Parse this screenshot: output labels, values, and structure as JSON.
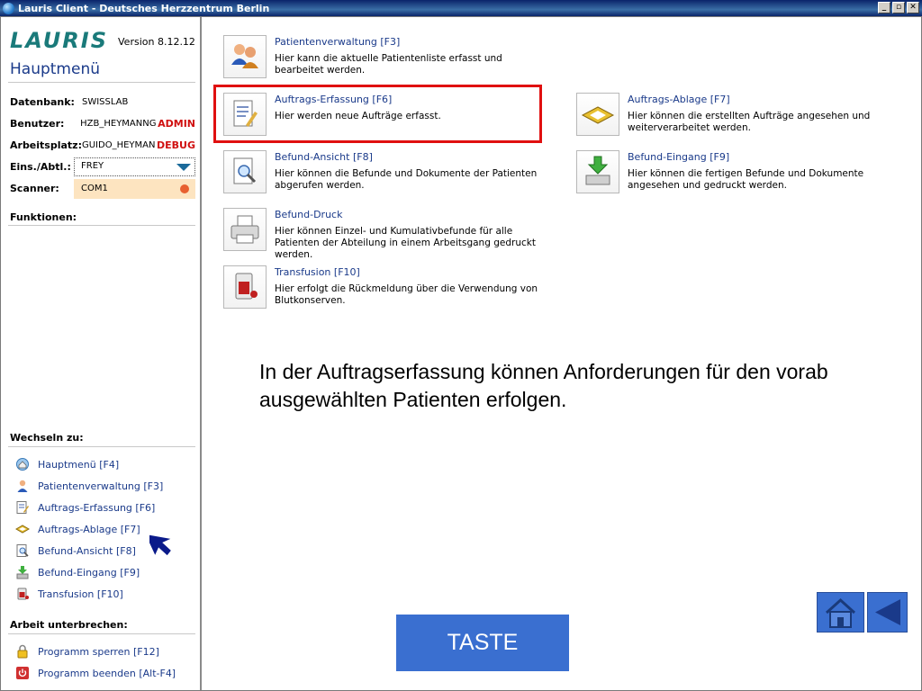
{
  "window": {
    "title": "Lauris Client - Deutsches Herzzentrum Berlin",
    "controls": [
      "_",
      "▫",
      "✕"
    ]
  },
  "sidebar": {
    "logo": "LAURIS",
    "version": "Version 8.12.12",
    "menu_title": "Hauptmenü",
    "info": {
      "datenbank_label": "Datenbank:",
      "datenbank_value": "SWISSLAB",
      "benutzer_label": "Benutzer:",
      "benutzer_value": "HZB_HEYMANNG",
      "benutzer_tag": "ADMIN",
      "arbeitsplatz_label": "Arbeitsplatz:",
      "arbeitsplatz_value": "GUIDO_HEYMAN",
      "arbeitsplatz_tag": "DEBUG",
      "einsabtl_label": "Eins./Abtl.:",
      "einsabtl_value": "FREY",
      "scanner_label": "Scanner:",
      "scanner_value": "COM1"
    },
    "funktionen_label": "Funktionen:",
    "wechseln_label": "Wechseln zu:",
    "wechseln_items": [
      {
        "label": "Hauptmenü [F4]",
        "icon": "home-icon"
      },
      {
        "label": "Patientenverwaltung [F3]",
        "icon": "patient-icon"
      },
      {
        "label": "Auftrags-Erfassung [F6]",
        "icon": "order-entry-icon"
      },
      {
        "label": "Auftrags-Ablage [F7]",
        "icon": "order-tray-icon"
      },
      {
        "label": "Befund-Ansicht [F8]",
        "icon": "magnifier-icon"
      },
      {
        "label": "Befund-Eingang [F9]",
        "icon": "inbox-icon"
      },
      {
        "label": "Transfusion [F10]",
        "icon": "transfusion-icon"
      }
    ],
    "unterbrechen_label": "Arbeit unterbrechen:",
    "unterbrechen_items": [
      {
        "label": "Programm sperren [F12]",
        "icon": "lock-icon"
      },
      {
        "label": "Programm beenden [Alt-F4]",
        "icon": "power-icon"
      }
    ]
  },
  "main": {
    "functions": [
      {
        "title": "Patientenverwaltung [F3]",
        "desc": "Hier kann die aktuelle Patientenliste erfasst und bearbeitet werden.",
        "icon": "patients-icon"
      },
      {
        "title": "Auftrags-Erfassung [F6]",
        "desc": "Hier werden neue Aufträge erfasst.",
        "icon": "order-entry-icon"
      },
      {
        "title": "Auftrags-Ablage [F7]",
        "desc": "Hier können die erstellten Aufträge angesehen und weiterverarbeitet werden.",
        "icon": "order-tray-icon"
      },
      {
        "title": "Befund-Ansicht [F8]",
        "desc": "Hier können die Befunde und Dokumente der Patienten abgerufen werden.",
        "icon": "magnifier-icon"
      },
      {
        "title": "Befund-Eingang [F9]",
        "desc": "Hier können die fertigen Befunde und Dokumente angesehen und gedruckt werden.",
        "icon": "inbox-icon"
      },
      {
        "title": "Befund-Druck",
        "desc": "Hier können Einzel- und Kumulativbefunde für alle Patienten der Abteilung in einem Arbeitsgang gedruckt werden.",
        "icon": "printer-icon"
      },
      {
        "title": "Transfusion [F10]",
        "desc": "Hier erfolgt die Rückmeldung über die Verwendung von Blutkonserven.",
        "icon": "transfusion-icon"
      }
    ],
    "caption": "In der Auftragserfassung können Anforderungen für den vorab ausgewählten Patienten erfolgen.",
    "taste_label": "TASTE"
  },
  "colors": {
    "accent_blue": "#3a6fd0",
    "link_blue": "#1a3a8a",
    "highlight_red": "#e01010",
    "tag_red": "#d01010",
    "scanner_bg": "#fde4c0"
  }
}
